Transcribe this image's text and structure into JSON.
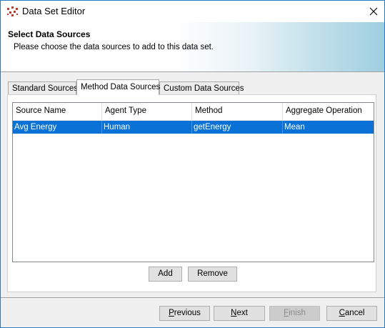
{
  "window": {
    "title": "Data Set Editor"
  },
  "banner": {
    "title": "Select Data Sources",
    "description": "Please choose the data sources to add to this data set."
  },
  "tabs": [
    {
      "label": "Standard Sources",
      "active": false
    },
    {
      "label": "Method Data Sources",
      "active": true
    },
    {
      "label": "Custom Data Sources",
      "active": false
    }
  ],
  "table": {
    "columns": [
      "Source Name",
      "Agent Type",
      "Method",
      "Aggregate Operation"
    ],
    "rows": [
      {
        "cells": [
          "Avg Energy",
          "Human",
          "getEnergy",
          "Mean"
        ],
        "selected": true
      }
    ]
  },
  "panel_buttons": {
    "add": "Add",
    "remove": "Remove"
  },
  "footer": {
    "previous": {
      "mnemonic": "P",
      "rest": "revious"
    },
    "next": {
      "mnemonic": "N",
      "rest": "ext"
    },
    "finish": {
      "mnemonic": "F",
      "rest": "inish",
      "disabled": true
    },
    "cancel": {
      "mnemonic": "C",
      "rest": "ancel"
    }
  },
  "colors": {
    "selection": "#0a72d6",
    "window_border": "#2b79c2"
  }
}
